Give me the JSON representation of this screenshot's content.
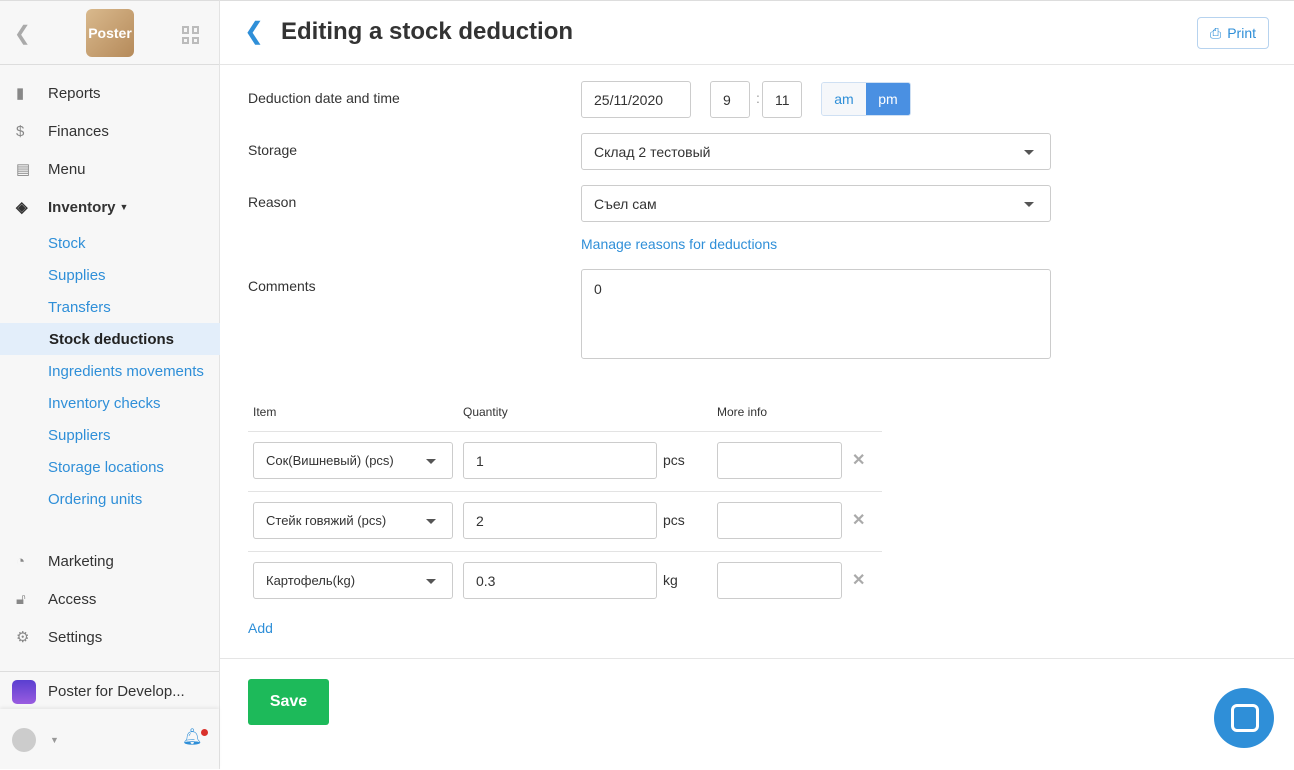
{
  "sidebar": {
    "logo": "Poster",
    "items": [
      {
        "label": "Reports",
        "icon": "bar-chart-icon"
      },
      {
        "label": "Finances",
        "icon": "dollar-icon"
      },
      {
        "label": "Menu",
        "icon": "document-icon"
      },
      {
        "label": "Inventory",
        "icon": "layers-icon"
      }
    ],
    "sub": [
      "Stock",
      "Supplies",
      "Transfers",
      "Stock deductions",
      "Ingredients movements",
      "Inventory checks",
      "Suppliers",
      "Storage locations",
      "Ordering units"
    ],
    "active": "Stock deductions",
    "bottom": [
      {
        "label": "Marketing",
        "icon": "pie-icon"
      },
      {
        "label": "Access",
        "icon": "lock-icon"
      },
      {
        "label": "Settings",
        "icon": "gear-icon"
      }
    ],
    "app": "Poster for Develop..."
  },
  "header": {
    "title": "Editing a stock deduction",
    "print": "Print"
  },
  "form": {
    "date_label": "Deduction date and time",
    "date": "25/11/2020",
    "hour": "9",
    "minute": "11",
    "am": "am",
    "pm": "pm",
    "ampm_selected": "pm",
    "storage_label": "Storage",
    "storage": "Склад 2 тестовый",
    "reason_label": "Reason",
    "reason": "Съел сам",
    "manage": "Manage reasons for deductions",
    "comments_label": "Comments",
    "comments": "0"
  },
  "table": {
    "headers": [
      "Item",
      "Quantity",
      "More info"
    ],
    "rows": [
      {
        "item": "Сок(Вишневый) (pcs)",
        "qty": "1",
        "unit": "pcs",
        "info": ""
      },
      {
        "item": "Стейк говяжий (pcs)",
        "qty": "2",
        "unit": "pcs",
        "info": ""
      },
      {
        "item": "Картофель(kg)",
        "qty": "0.3",
        "unit": "kg",
        "info": ""
      }
    ],
    "add": "Add"
  },
  "footer": {
    "save": "Save"
  },
  "colors": {
    "accent": "#2f8fd8",
    "save": "#1dba5a",
    "pm": "#4a90e2"
  }
}
